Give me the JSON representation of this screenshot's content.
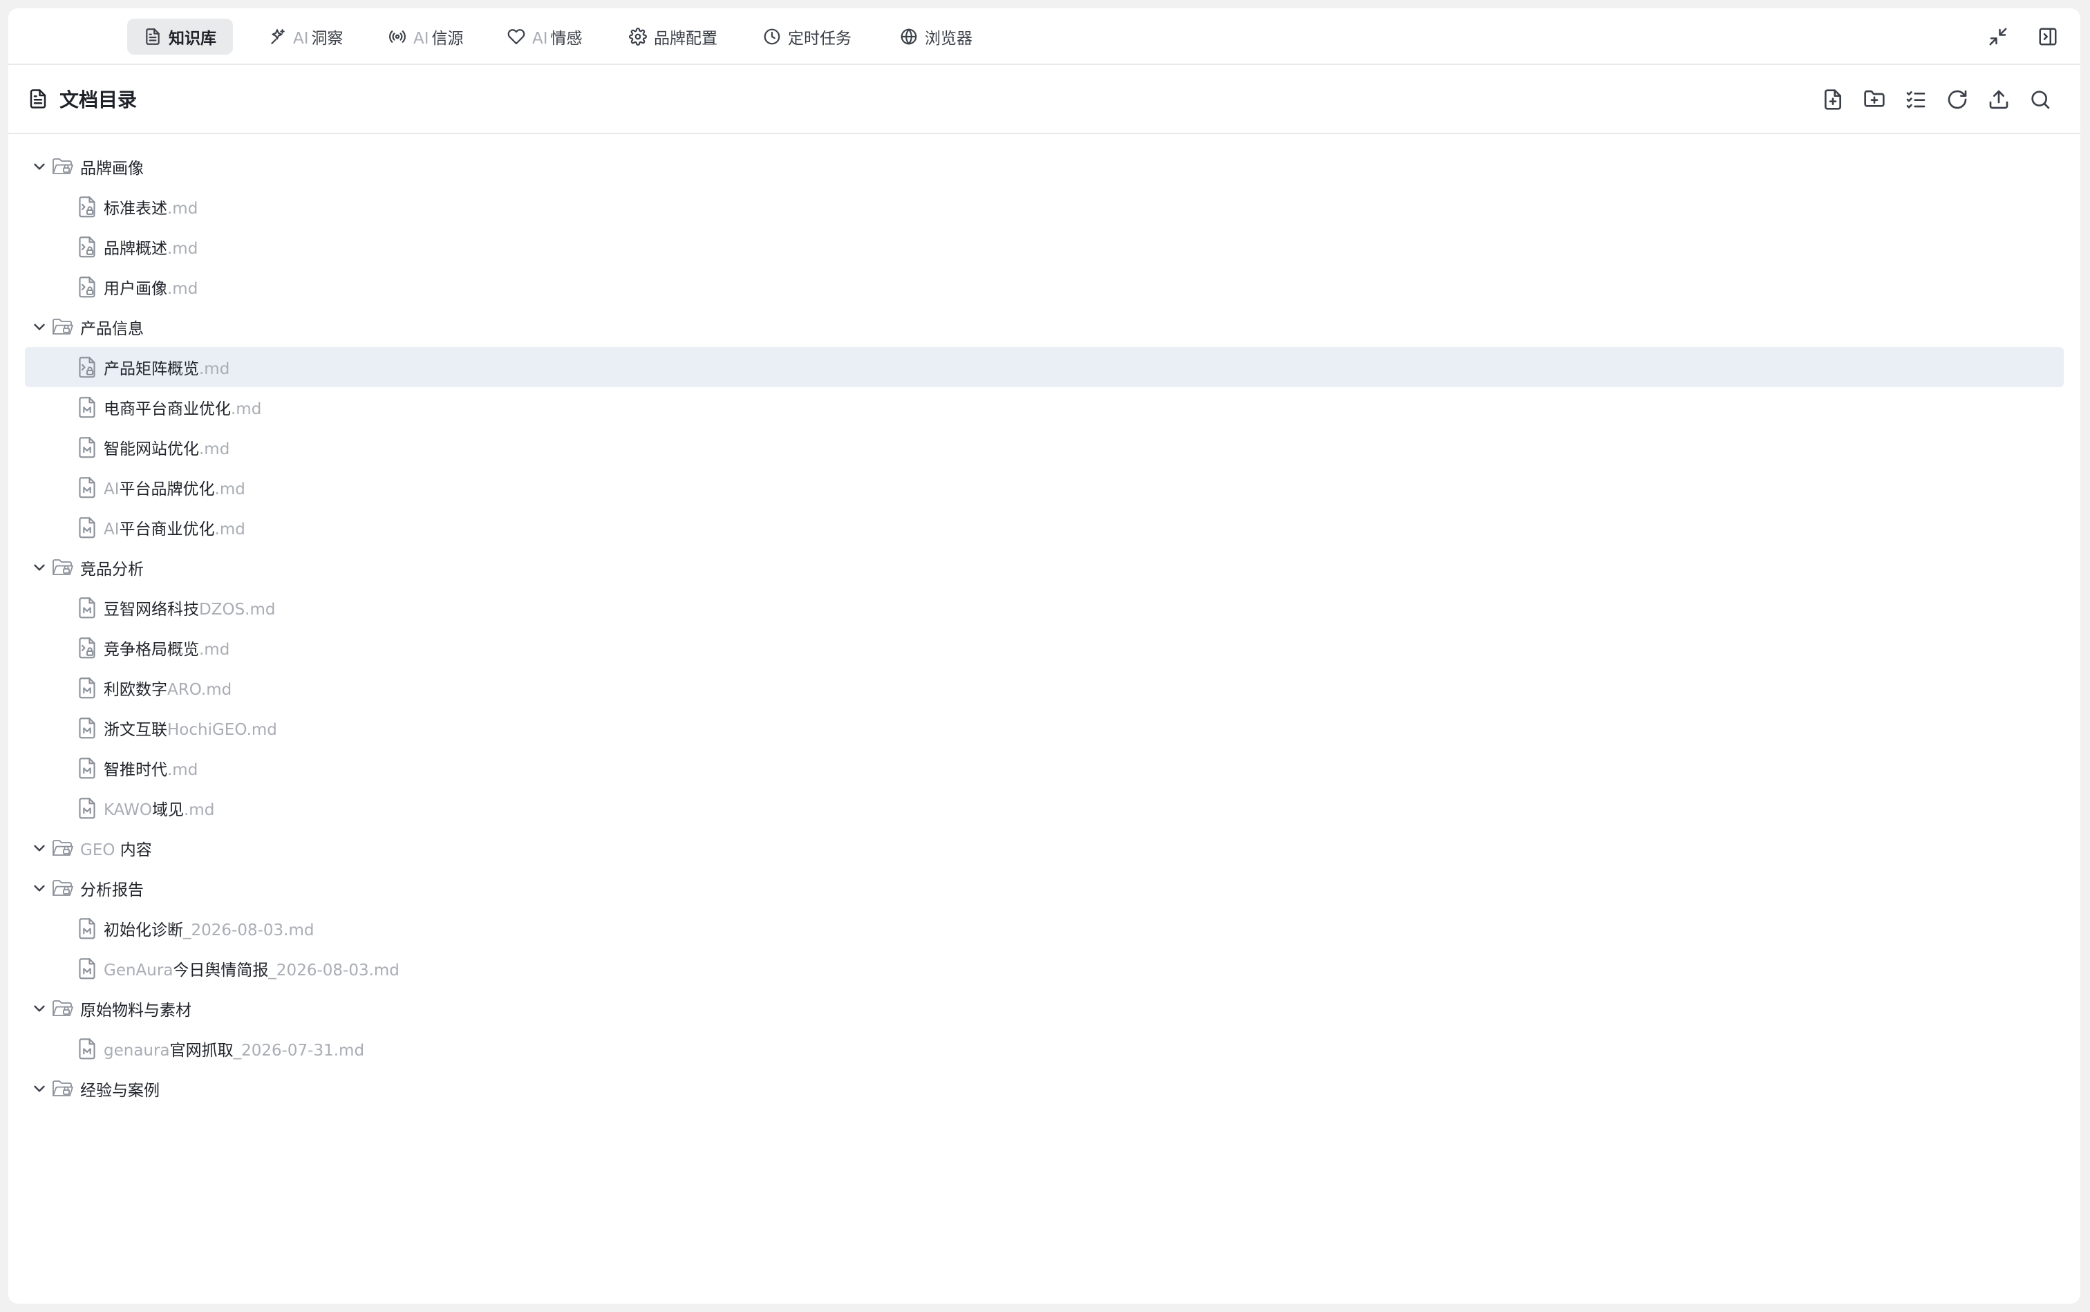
{
  "tabs": [
    {
      "name": "tab-knowledge-base",
      "icon": "document-icon",
      "prefix": "",
      "label": "知识库",
      "active": true
    },
    {
      "name": "tab-ai-insight",
      "icon": "sparkle-icon",
      "prefix": "AI",
      "label": "洞察",
      "active": false
    },
    {
      "name": "tab-ai-sources",
      "icon": "broadcast-icon",
      "prefix": "AI",
      "label": "信源",
      "active": false
    },
    {
      "name": "tab-ai-sentiment",
      "icon": "heart-icon",
      "prefix": "AI",
      "label": "情感",
      "active": false
    },
    {
      "name": "tab-brand-config",
      "icon": "gear-icon",
      "prefix": "",
      "label": "品牌配置",
      "active": false
    },
    {
      "name": "tab-scheduled-tasks",
      "icon": "clock-icon",
      "prefix": "",
      "label": "定时任务",
      "active": false
    },
    {
      "name": "tab-browser",
      "icon": "globe-icon",
      "prefix": "",
      "label": "浏览器",
      "active": false
    }
  ],
  "top_right_icons": [
    "minimize-icon",
    "sidebar-toggle-icon"
  ],
  "header": {
    "title": "文档目录",
    "title_icon": "document-icon",
    "actions": [
      "new-file-icon",
      "new-folder-icon",
      "list-check-icon",
      "refresh-icon",
      "upload-icon",
      "search-icon"
    ]
  },
  "tree": [
    {
      "type": "folder",
      "label": "品牌画像",
      "expanded": true
    },
    {
      "type": "file",
      "name": "标准表述",
      "ext": ".md"
    },
    {
      "type": "file",
      "name": "品牌概述",
      "ext": ".md"
    },
    {
      "type": "file",
      "name": "用户画像",
      "ext": ".md"
    },
    {
      "type": "folder",
      "label": "产品信息",
      "expanded": true
    },
    {
      "type": "file",
      "name": "产品矩阵概览",
      "ext": ".md",
      "selected": true
    },
    {
      "type": "file",
      "name": "电商平台商业优化",
      "ext": ".md"
    },
    {
      "type": "file",
      "name": "智能网站优化",
      "ext": ".md"
    },
    {
      "type": "file",
      "prefix": "AI",
      "name": "平台品牌优化",
      "ext": ".md"
    },
    {
      "type": "file",
      "prefix": "AI",
      "name": "平台商业优化",
      "ext": ".md"
    },
    {
      "type": "folder",
      "label": "竞品分析",
      "expanded": true
    },
    {
      "type": "file",
      "name": "豆智网络科技",
      "ext": "DZOS.md"
    },
    {
      "type": "file",
      "name": "竞争格局概览",
      "ext": ".md"
    },
    {
      "type": "file",
      "name": "利欧数字",
      "ext": "ARO.md"
    },
    {
      "type": "file",
      "name": "浙文互联",
      "ext": "HochiGEO.md"
    },
    {
      "type": "file",
      "name": "智推时代",
      "ext": ".md"
    },
    {
      "type": "file",
      "prefix": "KAWO",
      "name": "域见",
      "ext": ".md"
    },
    {
      "type": "folder",
      "prefix": "GEO",
      "label": " 内容",
      "expanded": true
    },
    {
      "type": "folder",
      "label": "分析报告",
      "expanded": true
    },
    {
      "type": "file",
      "name": "初始化诊断",
      "ext": "_2026-08-03.md"
    },
    {
      "type": "file",
      "prefix": "GenAura",
      "name": "今日舆情简报",
      "ext": "_2026-08-03.md"
    },
    {
      "type": "folder",
      "label": "原始物料与素材",
      "expanded": true
    },
    {
      "type": "file",
      "prefix": "genaura",
      "name": "官网抓取",
      "ext": "_2026-07-31.md"
    },
    {
      "type": "folder",
      "label": "经验与案例",
      "expanded": true
    }
  ]
}
